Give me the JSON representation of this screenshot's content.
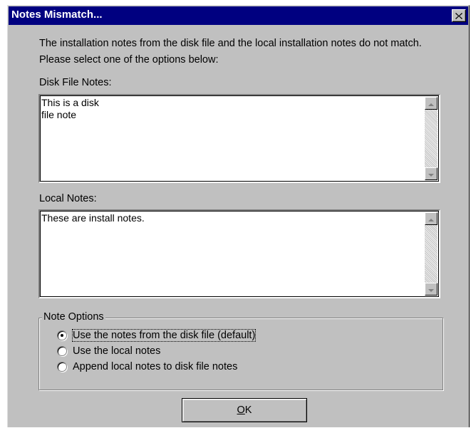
{
  "window": {
    "title": "Notes Mismatch...",
    "close_icon": "close-icon"
  },
  "message": "The installation notes from the disk file and the local installation notes do not match.  Please select one of the options below:",
  "disk_notes": {
    "label": "Disk File Notes:",
    "value": "This is a disk\nfile note"
  },
  "local_notes": {
    "label": "Local Notes:",
    "value": "These are install notes."
  },
  "note_options": {
    "title": "Note Options",
    "options": [
      {
        "label": "Use the notes from the disk file (default)",
        "selected": true
      },
      {
        "label": "Use the local notes",
        "selected": false
      },
      {
        "label": "Append local notes to disk file notes",
        "selected": false
      }
    ]
  },
  "ok_button": {
    "accel": "O",
    "rest": "K"
  },
  "colors": {
    "titlebar": "#000080",
    "face": "#c0c0c0"
  }
}
